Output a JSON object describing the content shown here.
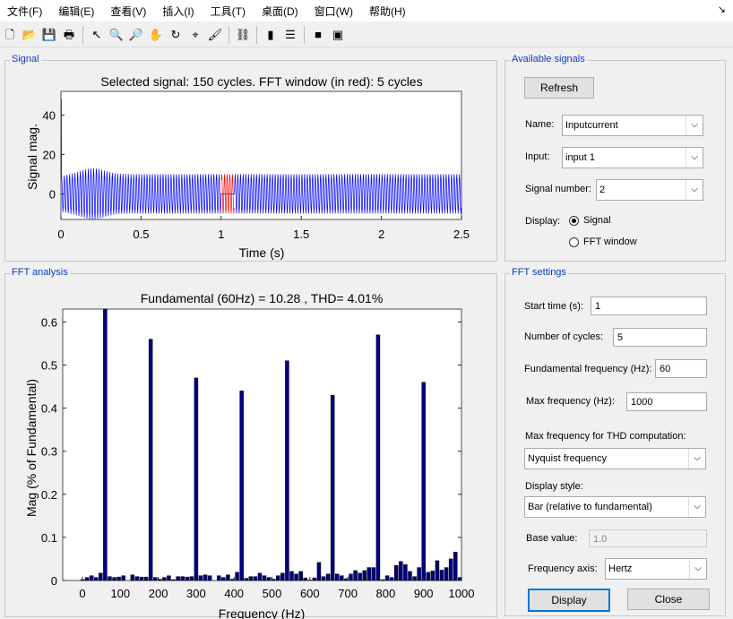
{
  "menu": [
    "文件(F)",
    "编辑(E)",
    "查看(V)",
    "插入(I)",
    "工具(T)",
    "桌面(D)",
    "窗口(W)",
    "帮助(H)"
  ],
  "toolbar": [
    "new-file",
    "open",
    "save",
    "print",
    "|",
    "pointer",
    "zoom-in",
    "zoom-out",
    "pan",
    "rotate",
    "data-cursor",
    "brush",
    "|",
    "link",
    "|",
    "colorbar",
    "legend",
    "|",
    "hide-plot-tools",
    "show-plot-tools"
  ],
  "signal_panel": {
    "title": "Signal",
    "plot_title": "Selected signal: 150 cycles. FFT window (in red): 5 cycles",
    "xlabel": "Time (s)",
    "ylabel": "Signal mag.",
    "xticks": [
      "0",
      "0.5",
      "1",
      "1.5",
      "2",
      "2.5"
    ],
    "yticks": [
      "0",
      "20",
      "40"
    ]
  },
  "fft_panel": {
    "title": "FFT analysis",
    "plot_title": "Fundamental (60Hz) = 10.28 , THD= 4.01%",
    "xlabel": "Frequency (Hz)",
    "ylabel": "Mag (% of Fundamental)"
  },
  "chart_data": [
    {
      "type": "line",
      "title": "Selected signal: 150 cycles. FFT window (in red): 5 cycles",
      "xlabel": "Time (s)",
      "ylabel": "Signal mag.",
      "xlim": [
        0,
        2.5
      ],
      "ylim": [
        -13,
        52
      ],
      "frequency_hz": 60,
      "initial_peak": 48,
      "steady_amplitude": 10,
      "fft_window": [
        1,
        1.0833
      ],
      "colors": {
        "signal": "#0000ff",
        "window": "#ff0000"
      }
    },
    {
      "type": "bar",
      "title": "Fundamental (60Hz) = 10.28 , THD= 4.01%",
      "xlabel": "Frequency (Hz)",
      "ylabel": "Mag (% of Fundamental)",
      "xlim": [
        -20,
        1000
      ],
      "ylim": [
        0,
        0.63
      ],
      "xticks": [
        0,
        100,
        200,
        300,
        400,
        500,
        600,
        700,
        800,
        900,
        1000
      ],
      "yticks": [
        0,
        0.1,
        0.2,
        0.3,
        0.4,
        0.5,
        0.6
      ],
      "bin_hz": 12,
      "values": [
        0.002,
        0.007,
        0.011,
        0.007,
        0.017,
        100,
        0.009,
        0.007,
        0.008,
        0.011,
        0,
        0.013,
        0.009,
        0.008,
        0.008,
        0.56,
        0.007,
        0.003,
        0.007,
        0.011,
        0.002,
        0.009,
        0.009,
        0.008,
        0.009,
        0.47,
        0.011,
        0.013,
        0.011,
        0,
        0.011,
        0.007,
        0.013,
        0.003,
        0.019,
        0.44,
        0.005,
        0.009,
        0.009,
        0.017,
        0.011,
        0.007,
        0.003,
        0.011,
        0.017,
        0.51,
        0.021,
        0.015,
        0.021,
        0.006,
        0.001,
        0.006,
        0.042,
        0.009,
        0.015,
        0.43,
        0.015,
        0.011,
        0.004,
        0.015,
        0.023,
        0.017,
        0.023,
        0.03,
        0.03,
        0.57,
        0.002,
        0.011,
        0.007,
        0.035,
        0.044,
        0.037,
        0.021,
        0.009,
        0.03,
        0.46,
        0.019,
        0.022,
        0.046,
        0.024,
        0.03,
        0.05,
        0.066,
        0.007
      ],
      "color": "#000080"
    }
  ],
  "available": {
    "title": "Available signals",
    "refresh": "Refresh",
    "name_label": "Name:",
    "name_value": "Inputcurrent",
    "input_label": "Input:",
    "input_value": "input 1",
    "signal_label": "Signal number:",
    "signal_value": "2",
    "display_label": "Display:",
    "display_options": [
      "Signal",
      "FFT window"
    ],
    "display_selected": 0
  },
  "settings": {
    "title": "FFT settings",
    "start_label": "Start time (s):",
    "start_value": "1",
    "cycles_label": "Number of cycles:",
    "cycles_value": "5",
    "fund_label": "Fundamental frequency (Hz):",
    "fund_value": "60",
    "maxf_label": "Max frequency (Hz):",
    "maxf_value": "1000",
    "thd_label": "Max frequency for THD computation:",
    "thd_value": "Nyquist frequency",
    "style_label": "Display style:",
    "style_value": "Bar (relative to fundamental)",
    "base_label": "Base value:",
    "base_value": "1.0",
    "axis_label": "Frequency axis:",
    "axis_value": "Hertz",
    "display_btn": "Display",
    "close_btn": "Close"
  }
}
